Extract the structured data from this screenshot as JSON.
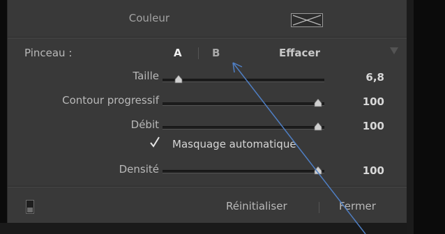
{
  "color": {
    "label": "Couleur"
  },
  "brush": {
    "label": "Pinceau :",
    "tab_a": "A",
    "tab_b": "B",
    "erase": "Effacer"
  },
  "sliders": [
    {
      "label": "Taille",
      "value_text": "6,8",
      "position": 0.1
    },
    {
      "label": "Contour progressif",
      "value_text": "100",
      "position": 0.96
    },
    {
      "label": "Débit",
      "value_text": "100",
      "position": 0.96
    },
    {
      "label": "Densité",
      "value_text": "100",
      "position": 0.96
    }
  ],
  "auto_mask": {
    "label": "Masquage automatique",
    "checked": true
  },
  "footer": {
    "reset": "Réinitialiser",
    "close": "Fermer"
  },
  "colors": {
    "panel_bg": "#393939",
    "text": "#b9b9b9",
    "annotation_arrow": "#4f7fc4"
  }
}
